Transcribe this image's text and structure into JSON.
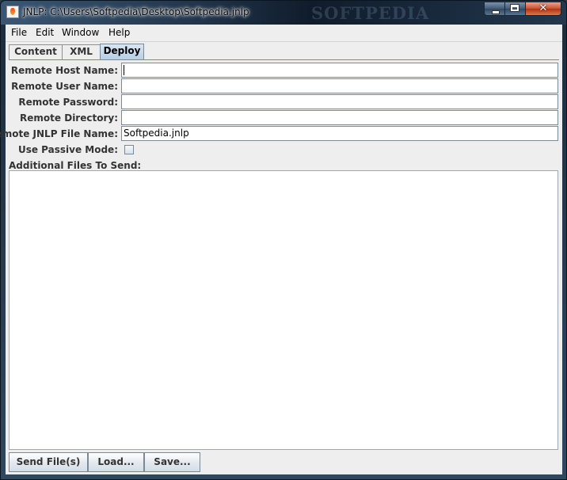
{
  "window": {
    "title": "JNLP: C:\\Users\\Softpedia\\Desktop\\Softpedia.jnlp",
    "watermark": "SOFTPEDIA",
    "accent": "#b8cfe5"
  },
  "menubar": {
    "items": [
      {
        "label": "File"
      },
      {
        "label": "Edit"
      },
      {
        "label": "Window"
      },
      {
        "label": "Help"
      }
    ]
  },
  "tabs": [
    {
      "label": "Content",
      "selected": false
    },
    {
      "label": "XML",
      "selected": false
    },
    {
      "label": "Deploy",
      "selected": true
    }
  ],
  "form": {
    "remote_host_label": "Remote Host Name:",
    "remote_host_value": "",
    "remote_user_label": "Remote User Name:",
    "remote_user_value": "",
    "remote_password_label": "Remote Password:",
    "remote_password_value": "",
    "remote_directory_label": "Remote Directory:",
    "remote_directory_value": "",
    "remote_jnlp_label": "Remote JNLP File Name:",
    "remote_jnlp_value": "Softpedia.jnlp",
    "passive_mode_label": "Use Passive Mode:",
    "passive_mode_checked": false,
    "additional_files_label": "Additional Files To Send:"
  },
  "buttons": {
    "send": "Send File(s)",
    "load": "Load...",
    "save": "Save..."
  },
  "icons": {
    "app": "java-cup-icon",
    "minimize": "minimize-icon",
    "maximize": "maximize-icon",
    "close": "close-icon"
  }
}
